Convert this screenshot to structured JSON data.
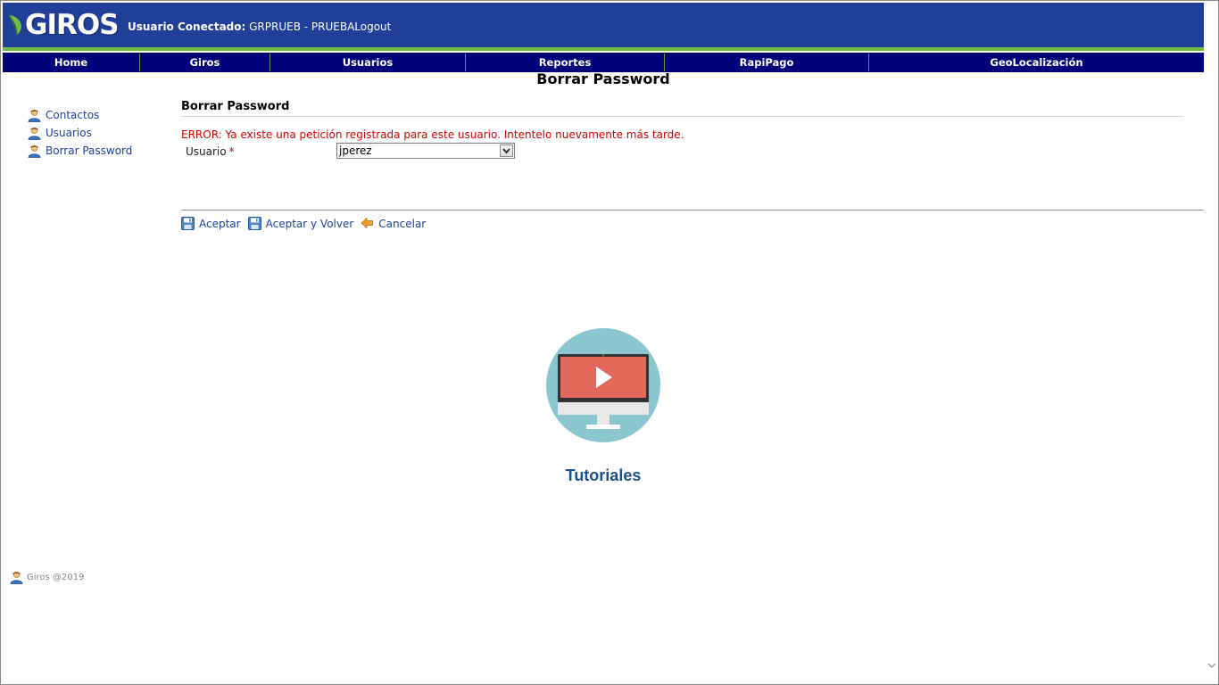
{
  "header": {
    "logo_text": "GIROS",
    "user_label": "Usuario Conectado:",
    "user_value": "GRPRUEB - PRUEBA",
    "logout": "Logout",
    "accent_color": "#1f3f99",
    "stripe_color": "#6fbe44"
  },
  "nav": {
    "items": [
      {
        "label": "Home"
      },
      {
        "label": "Giros"
      },
      {
        "label": "Usuarios"
      },
      {
        "label": "Reportes"
      },
      {
        "label": "RapiPago"
      },
      {
        "label": "GeoLocalización"
      }
    ],
    "background": "#00007a"
  },
  "page_title": "Borrar Password",
  "sidebar": {
    "items": [
      {
        "label": "Contactos",
        "icon": "user-icon"
      },
      {
        "label": "Usuarios",
        "icon": "user-icon"
      },
      {
        "label": "Borrar Password",
        "icon": "user-icon"
      }
    ]
  },
  "form": {
    "section_title": "Borrar Password",
    "error": "ERROR: Ya existe una petición registrada para este usuario. Intentelo nuevamente más tarde.",
    "usuario_label": "Usuario",
    "required_mark": "*",
    "usuario_value": "jperez"
  },
  "actions": [
    {
      "label": "Aceptar",
      "icon": "save-icon"
    },
    {
      "label": "Aceptar y Volver",
      "icon": "save-icon"
    },
    {
      "label": "Cancelar",
      "icon": "back-arrow-icon"
    }
  ],
  "tutorial": {
    "label": "Tutoriales",
    "icon": "video-monitor-icon"
  },
  "footer": {
    "text": "Giros @2019"
  }
}
